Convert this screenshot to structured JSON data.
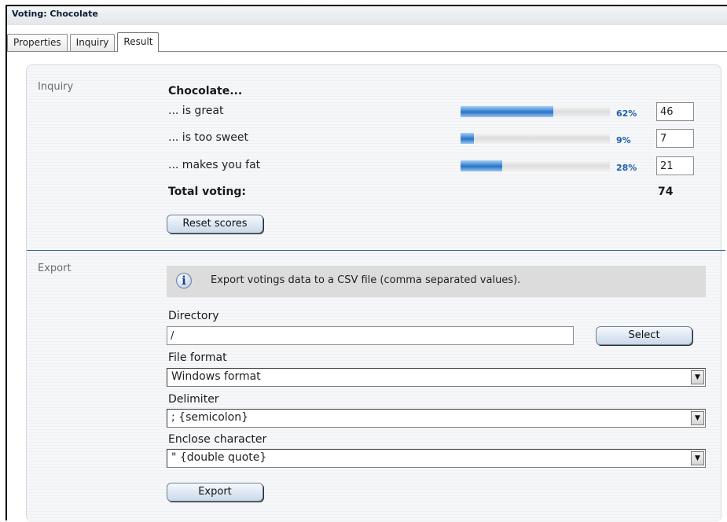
{
  "window": {
    "title": "Voting: Chocolate"
  },
  "tabs": [
    {
      "label": "Properties",
      "active": false
    },
    {
      "label": "Inquiry",
      "active": false
    },
    {
      "label": "Result",
      "active": true
    }
  ],
  "inquiry": {
    "section_label": "Inquiry",
    "question": "Chocolate...",
    "answers": [
      {
        "label": "... is great",
        "percent_label": "62%",
        "fraction": 0.62,
        "count": "46"
      },
      {
        "label": "... is too sweet",
        "percent_label": "9%",
        "fraction": 0.09,
        "count": "7"
      },
      {
        "label": "... makes you fat",
        "percent_label": "28%",
        "fraction": 0.28,
        "count": "21"
      }
    ],
    "total_label": "Total voting:",
    "total_value": "74",
    "reset_button": "Reset scores",
    "bar_color": "#2a73c6",
    "percent_color": "#1e5fa6"
  },
  "export": {
    "section_label": "Export",
    "info_icon": "info-icon",
    "info_text": "Export votings data to a CSV file (comma separated values).",
    "directory": {
      "label": "Directory",
      "value": "/",
      "select_button": "Select"
    },
    "file_format": {
      "label": "File format",
      "value": "Windows format"
    },
    "delimiter": {
      "label": "Delimiter",
      "value": "; {semicolon}"
    },
    "enclose": {
      "label": "Enclose character",
      "value": "\" {double quote}"
    },
    "export_button": "Export",
    "divider_color": "#2f64a0"
  }
}
